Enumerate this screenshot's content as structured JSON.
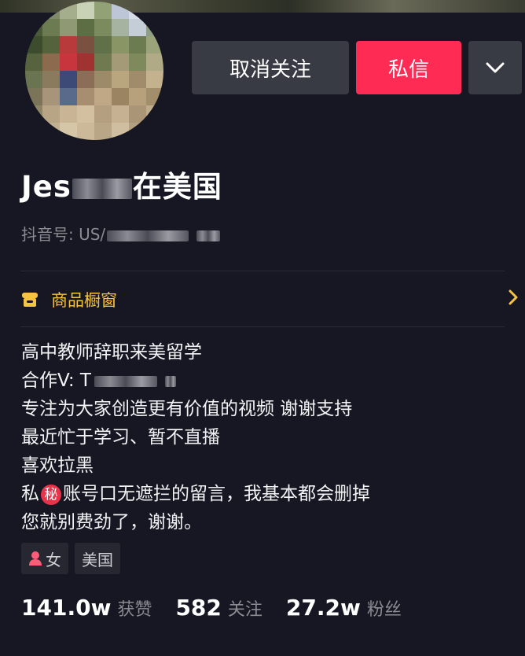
{
  "header": {
    "unfollow_label": "取消关注",
    "message_label": "私信",
    "more_icon": "chevron-down-icon"
  },
  "profile": {
    "name_prefix": "Jes",
    "name_suffix": "在美国",
    "uid_label": "抖音号: US/"
  },
  "shop": {
    "icon": "storefront-icon",
    "label": "商品橱窗",
    "chevron_icon": "chevron-right-icon"
  },
  "bio": {
    "line1": "高中教师辞职来美留学",
    "line2": "合作V: T",
    "line3": "专注为大家创造更有价值的视频 谢谢支持",
    "line4": "最近忙于学习、暂不直播",
    "line5": "喜欢拉黑",
    "line6_pre": "私",
    "line6_badge": "秘",
    "line6_post": "账号口无遮拦的留言，我基本都会删掉",
    "line7": "您就别费劲了，谢谢。"
  },
  "tags": {
    "gender_icon": "female-icon",
    "gender": "女",
    "location": "美国"
  },
  "stats": {
    "likes_value": "141.0w",
    "likes_label": "获赞",
    "following_value": "582",
    "following_label": "关注",
    "followers_value": "27.2w",
    "followers_label": "粉丝"
  },
  "colors": {
    "background": "#161722",
    "accent": "#fe2c55",
    "button_gray": "#393b44",
    "shop_yellow": "#f6c342"
  }
}
